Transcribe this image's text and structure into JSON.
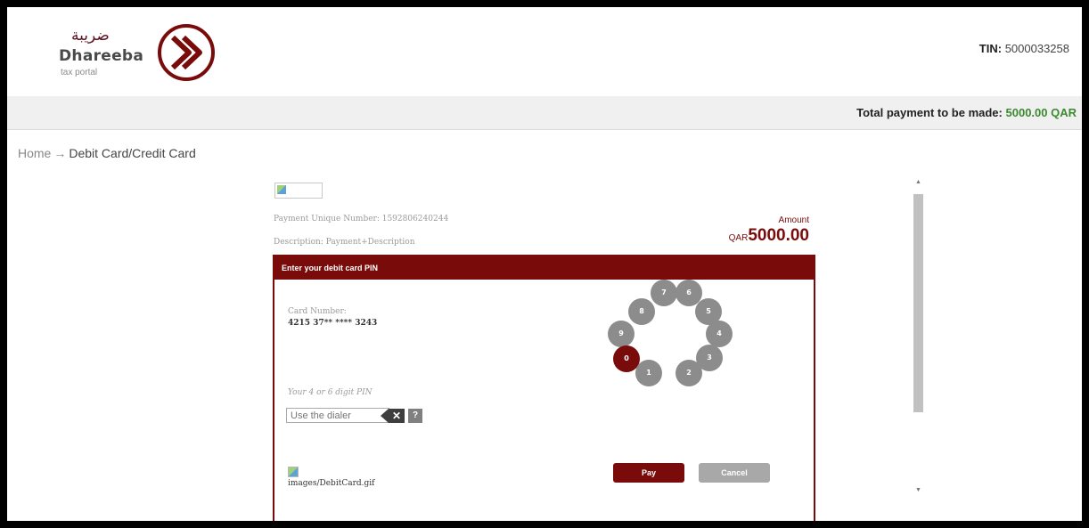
{
  "header": {
    "logo_arabic": "ضريبة",
    "logo_name": "Dhareeba",
    "logo_sub": "tax portal",
    "tin_label": "TIN:",
    "tin_value": "5000033258"
  },
  "paybar": {
    "label": "Total payment to be made:",
    "amount": "5000.00 QAR"
  },
  "breadcrumb": {
    "home": "Home",
    "arrow": "→",
    "current": "Debit Card/Credit Card"
  },
  "payment": {
    "unique_number": "Payment Unique Number: 1592806240244",
    "description": "Description: Payment+Description",
    "amount_label": "Amount",
    "currency": "QAR",
    "amount_value": "5000.00",
    "panel_title": "Enter your debit card PIN",
    "card_number_label": "Card Number:",
    "card_number": "4215 37** **** 3243",
    "pin_label": "Your 4 or 6 digit PIN",
    "pin_placeholder": "Use the dialer",
    "clear_label": "✕",
    "help_label": "?",
    "card_image_alt": "images/DebitCard.gif",
    "pay_label": "Pay",
    "cancel_label": "Cancel",
    "dialer": {
      "d0": "0",
      "d1": "1",
      "d2": "2",
      "d3": "3",
      "d4": "4",
      "d5": "5",
      "d6": "6",
      "d7": "7",
      "d8": "8",
      "d9": "9",
      "active": "0"
    }
  },
  "colors": {
    "brand": "#7a0b0b",
    "total_green": "#3a8a2e",
    "dial_gray": "#8c8c8c"
  }
}
